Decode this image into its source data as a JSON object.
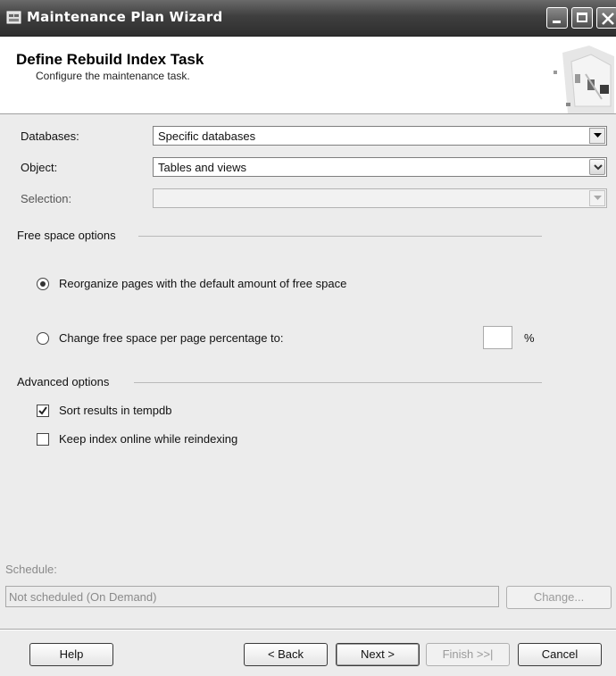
{
  "window": {
    "title": "Maintenance Plan Wizard",
    "buttons": {
      "minimize": "minimize",
      "maximize": "maximize",
      "close": "close"
    }
  },
  "header": {
    "title": "Define Rebuild Index Task",
    "subtitle": "Configure the maintenance task."
  },
  "form": {
    "databases": {
      "label": "Databases:",
      "value": "Specific databases"
    },
    "object": {
      "label": "Object:",
      "value": "Tables and views"
    },
    "selection": {
      "label": "Selection:",
      "value": ""
    }
  },
  "free_space": {
    "group_title": "Free space options",
    "option_reorganize": "Reorganize pages with the default amount of free space",
    "option_change": "Change free space per page percentage to:",
    "selected": "reorganize",
    "percent_value": "",
    "percent_sign": "%"
  },
  "advanced": {
    "group_title": "Advanced options",
    "sort_in_tempdb": {
      "label": "Sort results in tempdb",
      "checked": true
    },
    "keep_online": {
      "label": "Keep index online while reindexing",
      "checked": false
    }
  },
  "schedule": {
    "label": "Schedule:",
    "value": "Not scheduled (On Demand)",
    "change_button": "Change..."
  },
  "footer": {
    "help": "Help",
    "back": "< Back",
    "next": "Next >",
    "finish": "Finish >>|",
    "cancel": "Cancel"
  },
  "icons": [
    "app-icon",
    "wizard-graphic-icon",
    "chevron-down-icon",
    "checkmark-icon",
    "close-icon"
  ],
  "colors": {
    "titlebar": "#3f3f3f",
    "header_bg": "#ffffff",
    "body_bg": "#ececec",
    "disabled_text": "#8a8a8a"
  }
}
